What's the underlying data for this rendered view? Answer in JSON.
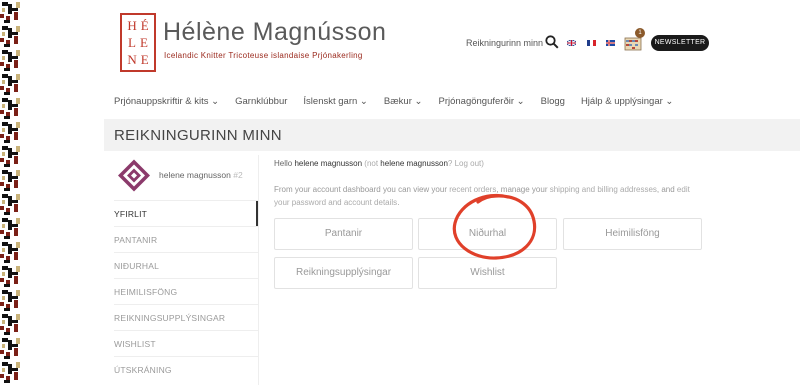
{
  "brand": {
    "logo_letters": [
      "HÉ",
      "LE",
      "NE"
    ],
    "name": "Hélène Magnússon",
    "tagline": "Icelandic Knitter   Tricoteuse islandaise   Prjónakerling"
  },
  "header": {
    "account_link": "Reikningurinn minn",
    "cart_count": "1",
    "newsletter_label": "NEWSLETTER"
  },
  "nav": {
    "items": [
      "Prjónauppskriftir & kits",
      "Garnklúbbur",
      "Íslenskt garn",
      "Bækur",
      "Prjónagönguferðir",
      "Blogg",
      "Hjálp & upplýsingar"
    ],
    "dropdown_flags": [
      true,
      false,
      true,
      true,
      true,
      false,
      true
    ]
  },
  "page": {
    "title": "REIKNINGURINN MINN"
  },
  "sidebar": {
    "user_name": "helene magnusson",
    "user_id": "#2",
    "items": [
      "YFIRLIT",
      "PANTANIR",
      "NIÐURHAL",
      "HEIMILISFÖNG",
      "REIKNINGSUPPLÝSINGAR",
      "WISHLIST",
      "ÚTSKRÁNING"
    ],
    "active_index": 0
  },
  "main": {
    "hello_prefix": "Hello ",
    "hello_name": "helene magnusson",
    "hello_not": " (not ",
    "hello_name2": "helene magnusson",
    "hello_logout": "? Log out)",
    "dash_1": "From your account dashboard you can view your ",
    "dash_recent": "recent orders",
    "dash_2": ", manage your ",
    "dash_addresses": "shipping and billing addresses",
    "dash_3": ", and ",
    "dash_edit": "edit your password and account details",
    "dash_4": ".",
    "tiles": [
      "Pantanir",
      "Niðurhal",
      "Heimilisföng",
      "Reikningsupplýsingar",
      "Wishlist"
    ]
  },
  "colors": {
    "brand_red": "#c0392b",
    "annotation_red": "#e0402a",
    "newsletter_bg": "#1a1a1a"
  }
}
